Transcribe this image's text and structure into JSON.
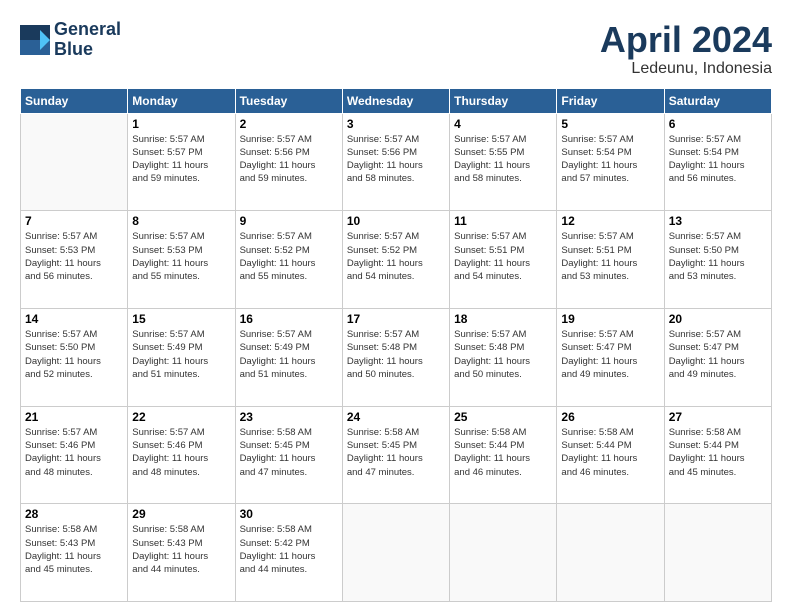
{
  "header": {
    "logo_line1": "General",
    "logo_line2": "Blue",
    "month": "April 2024",
    "location": "Ledeunu, Indonesia"
  },
  "weekdays": [
    "Sunday",
    "Monday",
    "Tuesday",
    "Wednesday",
    "Thursday",
    "Friday",
    "Saturday"
  ],
  "weeks": [
    [
      {
        "day": "",
        "detail": ""
      },
      {
        "day": "1",
        "detail": "Sunrise: 5:57 AM\nSunset: 5:57 PM\nDaylight: 11 hours\nand 59 minutes."
      },
      {
        "day": "2",
        "detail": "Sunrise: 5:57 AM\nSunset: 5:56 PM\nDaylight: 11 hours\nand 59 minutes."
      },
      {
        "day": "3",
        "detail": "Sunrise: 5:57 AM\nSunset: 5:56 PM\nDaylight: 11 hours\nand 58 minutes."
      },
      {
        "day": "4",
        "detail": "Sunrise: 5:57 AM\nSunset: 5:55 PM\nDaylight: 11 hours\nand 58 minutes."
      },
      {
        "day": "5",
        "detail": "Sunrise: 5:57 AM\nSunset: 5:54 PM\nDaylight: 11 hours\nand 57 minutes."
      },
      {
        "day": "6",
        "detail": "Sunrise: 5:57 AM\nSunset: 5:54 PM\nDaylight: 11 hours\nand 56 minutes."
      }
    ],
    [
      {
        "day": "7",
        "detail": "Sunrise: 5:57 AM\nSunset: 5:53 PM\nDaylight: 11 hours\nand 56 minutes."
      },
      {
        "day": "8",
        "detail": "Sunrise: 5:57 AM\nSunset: 5:53 PM\nDaylight: 11 hours\nand 55 minutes."
      },
      {
        "day": "9",
        "detail": "Sunrise: 5:57 AM\nSunset: 5:52 PM\nDaylight: 11 hours\nand 55 minutes."
      },
      {
        "day": "10",
        "detail": "Sunrise: 5:57 AM\nSunset: 5:52 PM\nDaylight: 11 hours\nand 54 minutes."
      },
      {
        "day": "11",
        "detail": "Sunrise: 5:57 AM\nSunset: 5:51 PM\nDaylight: 11 hours\nand 54 minutes."
      },
      {
        "day": "12",
        "detail": "Sunrise: 5:57 AM\nSunset: 5:51 PM\nDaylight: 11 hours\nand 53 minutes."
      },
      {
        "day": "13",
        "detail": "Sunrise: 5:57 AM\nSunset: 5:50 PM\nDaylight: 11 hours\nand 53 minutes."
      }
    ],
    [
      {
        "day": "14",
        "detail": "Sunrise: 5:57 AM\nSunset: 5:50 PM\nDaylight: 11 hours\nand 52 minutes."
      },
      {
        "day": "15",
        "detail": "Sunrise: 5:57 AM\nSunset: 5:49 PM\nDaylight: 11 hours\nand 51 minutes."
      },
      {
        "day": "16",
        "detail": "Sunrise: 5:57 AM\nSunset: 5:49 PM\nDaylight: 11 hours\nand 51 minutes."
      },
      {
        "day": "17",
        "detail": "Sunrise: 5:57 AM\nSunset: 5:48 PM\nDaylight: 11 hours\nand 50 minutes."
      },
      {
        "day": "18",
        "detail": "Sunrise: 5:57 AM\nSunset: 5:48 PM\nDaylight: 11 hours\nand 50 minutes."
      },
      {
        "day": "19",
        "detail": "Sunrise: 5:57 AM\nSunset: 5:47 PM\nDaylight: 11 hours\nand 49 minutes."
      },
      {
        "day": "20",
        "detail": "Sunrise: 5:57 AM\nSunset: 5:47 PM\nDaylight: 11 hours\nand 49 minutes."
      }
    ],
    [
      {
        "day": "21",
        "detail": "Sunrise: 5:57 AM\nSunset: 5:46 PM\nDaylight: 11 hours\nand 48 minutes."
      },
      {
        "day": "22",
        "detail": "Sunrise: 5:57 AM\nSunset: 5:46 PM\nDaylight: 11 hours\nand 48 minutes."
      },
      {
        "day": "23",
        "detail": "Sunrise: 5:58 AM\nSunset: 5:45 PM\nDaylight: 11 hours\nand 47 minutes."
      },
      {
        "day": "24",
        "detail": "Sunrise: 5:58 AM\nSunset: 5:45 PM\nDaylight: 11 hours\nand 47 minutes."
      },
      {
        "day": "25",
        "detail": "Sunrise: 5:58 AM\nSunset: 5:44 PM\nDaylight: 11 hours\nand 46 minutes."
      },
      {
        "day": "26",
        "detail": "Sunrise: 5:58 AM\nSunset: 5:44 PM\nDaylight: 11 hours\nand 46 minutes."
      },
      {
        "day": "27",
        "detail": "Sunrise: 5:58 AM\nSunset: 5:44 PM\nDaylight: 11 hours\nand 45 minutes."
      }
    ],
    [
      {
        "day": "28",
        "detail": "Sunrise: 5:58 AM\nSunset: 5:43 PM\nDaylight: 11 hours\nand 45 minutes."
      },
      {
        "day": "29",
        "detail": "Sunrise: 5:58 AM\nSunset: 5:43 PM\nDaylight: 11 hours\nand 44 minutes."
      },
      {
        "day": "30",
        "detail": "Sunrise: 5:58 AM\nSunset: 5:42 PM\nDaylight: 11 hours\nand 44 minutes."
      },
      {
        "day": "",
        "detail": ""
      },
      {
        "day": "",
        "detail": ""
      },
      {
        "day": "",
        "detail": ""
      },
      {
        "day": "",
        "detail": ""
      }
    ]
  ]
}
